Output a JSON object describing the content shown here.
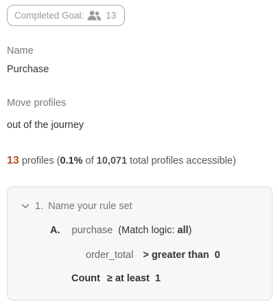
{
  "badge": {
    "label": "Completed Goal:",
    "icon": "people-icon",
    "count": "13"
  },
  "fields": {
    "name_label": "Name",
    "name_value": "Purchase",
    "move_label": "Move profiles",
    "move_value": "out of the journey"
  },
  "summary": {
    "count": "13",
    "text_profiles": "profiles (",
    "percent": "0.1%",
    "text_of": "of",
    "total": "10,071",
    "text_tail": "total profiles accessible)"
  },
  "ruleset": {
    "index": "1.",
    "title": "Name your rule set",
    "rule": {
      "letter": "A.",
      "event": "purchase",
      "logic_prefix": "(Match logic:",
      "logic_value": "all",
      "logic_suffix": ")"
    },
    "condition": {
      "property": "order_total",
      "operator": "> greater than",
      "value": "0"
    },
    "count": {
      "label": "Count",
      "operator": "≥ at least",
      "value": "1"
    }
  },
  "colors": {
    "accent_count": "#b4532a",
    "panel_bg": "#f7f7f7"
  }
}
